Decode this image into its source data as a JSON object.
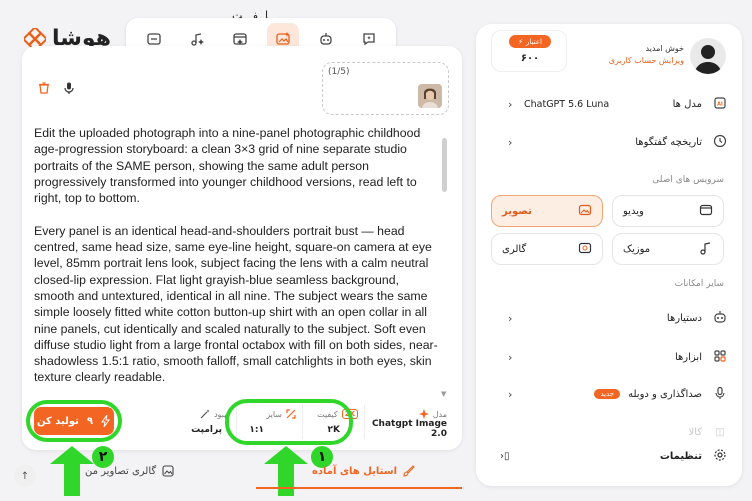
{
  "app": {
    "logo_text": "هوشا",
    "top_title": "ـا ـفـ ـت"
  },
  "top_tabs": [
    {
      "icon": "chat-bubble-icon"
    },
    {
      "icon": "robot-icon"
    },
    {
      "icon": "image-sparkle-icon",
      "active": true
    },
    {
      "icon": "video-sparkle-icon"
    },
    {
      "icon": "music-sparkle-icon"
    },
    {
      "icon": "folder-icon"
    }
  ],
  "compose": {
    "upload_count": "(1/5)",
    "prompt": "Edit the uploaded photograph into a nine-panel photographic childhood age-progression storyboard: a clean 3×3 grid of nine separate studio portraits of the SAME person, showing the same adult person progressively transformed into younger childhood versions, read left to right, top to bottom.\n\nEvery panel is an identical head-and-shoulders portrait bust — head centred, same head size, same eye-line height, square-on camera at eye level, 85mm portrait lens look, subject facing the lens with a calm neutral closed-lip expression. Flat light grayish-blue seamless background, smooth and untextured, identical in all nine. The subject wears the same simple loosely fitted white cotton button-up shirt with an open collar in all nine panels, cut identically and scaled naturally to the subject. Soft even diffuse studio light from a large frontal octabox with fill on both sides, near-shadowless 1.5:1 ratio, smooth falloff, small catchlights in both eyes, skin texture clearly readable.",
    "settings": {
      "model_label": "مدل",
      "model_value": "Chatgpt Image 2.0",
      "quality_label": "کیفیت",
      "quality_badge": "2K",
      "quality_value": "۲K",
      "size_label": "سایز",
      "size_value": "۱:۱",
      "enhance_label": "بهبود",
      "enhance_value": "پرامپت"
    },
    "generate_label": "تولید کن",
    "generate_cost": "۹",
    "annotation_1": "۱",
    "annotation_2": "۲"
  },
  "bottom_tabs": {
    "presets": "استایل های آماده",
    "gallery": "گالری تصاویر من"
  },
  "sidebar": {
    "welcome": "خوش امدید",
    "edit_profile": "ویرایش حساب کاربری",
    "credit_label": "اعتبار",
    "credit_value": "۶۰۰",
    "models_label": "مدل ها",
    "model_selected": "ChatGPT 5.6 Luna",
    "history_label": "تاریخچه گفتگوها",
    "main_services_title": "سرویس های اصلی",
    "services": {
      "image": "تصویر",
      "video": "ویدیو",
      "gallery": "گالری",
      "music": "موزیک"
    },
    "other_title": "سایر امکانات",
    "assistants": "دستیارها",
    "tools": "ابزارها",
    "dubbing": "صداگذاری و دوبله",
    "new_badge": "جدید",
    "settings": "تنظیمات",
    "faded_item": "کالا"
  },
  "colors": {
    "accent": "#f26522",
    "annotation_green": "#31d62b"
  }
}
